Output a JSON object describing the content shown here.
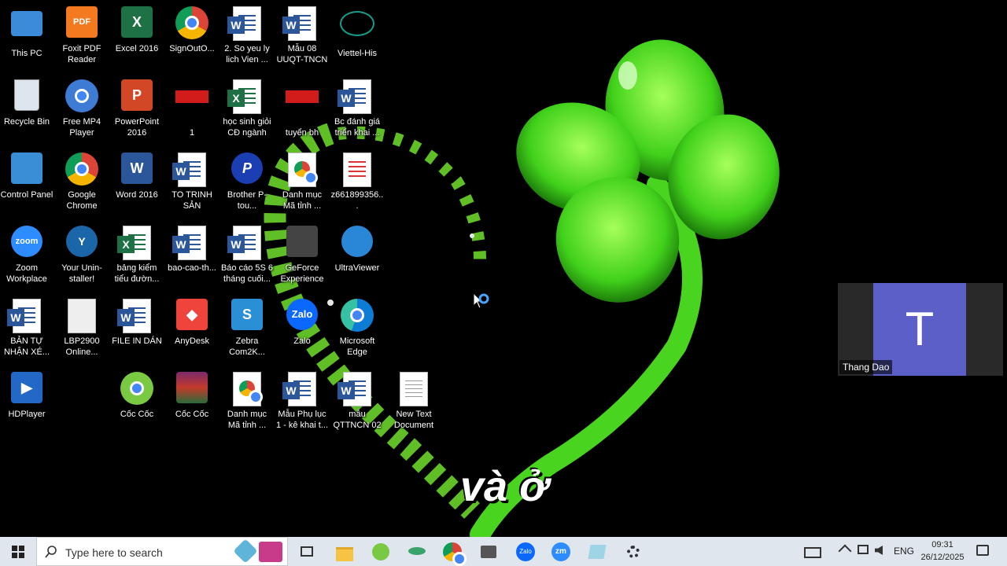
{
  "desktop": {
    "icons": [
      {
        "label": "This PC",
        "icon": "this-pc-icon"
      },
      {
        "label": "Foxit PDF Reader",
        "icon": "foxit-icon"
      },
      {
        "label": "Excel 2016",
        "icon": "excel-icon"
      },
      {
        "label": "SignOutO...",
        "icon": "chrome-icon"
      },
      {
        "label": "2. So yeu ly lich Vien ...",
        "icon": "word-doc-icon"
      },
      {
        "label": "Mẫu 08 UUQT-TNCN",
        "icon": "word-doc-icon"
      },
      {
        "label": "Viettel-His",
        "icon": "viettel-icon"
      },
      {
        "label": "Recycle Bin",
        "icon": "recycle-bin-icon"
      },
      {
        "label": "Free MP4 Player",
        "icon": "mp4-player-icon"
      },
      {
        "label": "PowerPoint 2016",
        "icon": "powerpoint-icon"
      },
      {
        "label": "1",
        "icon": "image-file-icon"
      },
      {
        "label": "học sinh giỏi CĐ ngành",
        "icon": "excel-doc-icon"
      },
      {
        "label": "tuyển bh",
        "icon": "image-file-icon"
      },
      {
        "label": "Bc đánh giá triển khai ...",
        "icon": "word-doc-icon"
      },
      {
        "label": "Control Panel",
        "icon": "control-panel-icon"
      },
      {
        "label": "Google Chrome",
        "icon": "chrome-icon"
      },
      {
        "label": "Word 2016",
        "icon": "word-icon"
      },
      {
        "label": "TO TRINH SẢN",
        "icon": "word-doc-icon"
      },
      {
        "label": "Brother P-tou...",
        "icon": "brother-icon"
      },
      {
        "label": "Danh mục Mã tỉnh ...",
        "icon": "chrome-doc-icon"
      },
      {
        "label": "z661899356...",
        "icon": "pdf-file-icon"
      },
      {
        "label": "Zoom Workplace",
        "icon": "zoom-icon"
      },
      {
        "label": "Your Unin-staller!",
        "icon": "uninstaller-icon"
      },
      {
        "label": "bảng kiểm tiểu đườn...",
        "icon": "excel-doc-icon"
      },
      {
        "label": "bao-cao-th...",
        "icon": "word-doc-icon"
      },
      {
        "label": "Báo cáo 5S 6 tháng cuối...",
        "icon": "word-doc-icon"
      },
      {
        "label": "GeForce Experience",
        "icon": "geforce-icon"
      },
      {
        "label": "UltraViewer",
        "icon": "ultraviewer-icon"
      },
      {
        "label": "BẢN TỰ NHẬN XÉ...",
        "icon": "word-doc-icon"
      },
      {
        "label": "LBP2900 Online...",
        "icon": "lbp-icon"
      },
      {
        "label": "FILE IN DÁN",
        "icon": "word-doc-icon"
      },
      {
        "label": "AnyDesk",
        "icon": "anydesk-icon"
      },
      {
        "label": "Zebra Com2K...",
        "icon": "zebra-icon"
      },
      {
        "label": "Zalo",
        "icon": "zalo-icon"
      },
      {
        "label": "Microsoft Edge",
        "icon": "edge-icon"
      },
      {
        "label": "HDPlayer",
        "icon": "hdplayer-icon"
      },
      {
        "label": "New Text Document",
        "icon": "text-file-icon"
      },
      {
        "label": "Cốc Cốc",
        "icon": "coccoc-icon"
      },
      {
        "label": "Cốc Cốc",
        "icon": "winrar-icon"
      },
      {
        "label": "Danh mục Mã tỉnh ...",
        "icon": "chrome-doc-icon"
      },
      {
        "label": "Mẫu Phụ lục 1 - kê khai t...",
        "icon": "word-doc-icon"
      },
      {
        "label": "mẫu QTTNCN 02",
        "icon": "word-doc-icon"
      }
    ]
  },
  "subtitle": "và ở",
  "teams": {
    "avatar_letter": "T",
    "name": "Thang Dao"
  },
  "taskbar": {
    "search_placeholder": "Type here to search",
    "language": "ENG",
    "time": "09:31",
    "date": "26/12/2025"
  },
  "colors": {
    "taskbar": "#dfe6ee",
    "teams_avatar": "#5b5fc7",
    "clover": "#4fe32a"
  }
}
